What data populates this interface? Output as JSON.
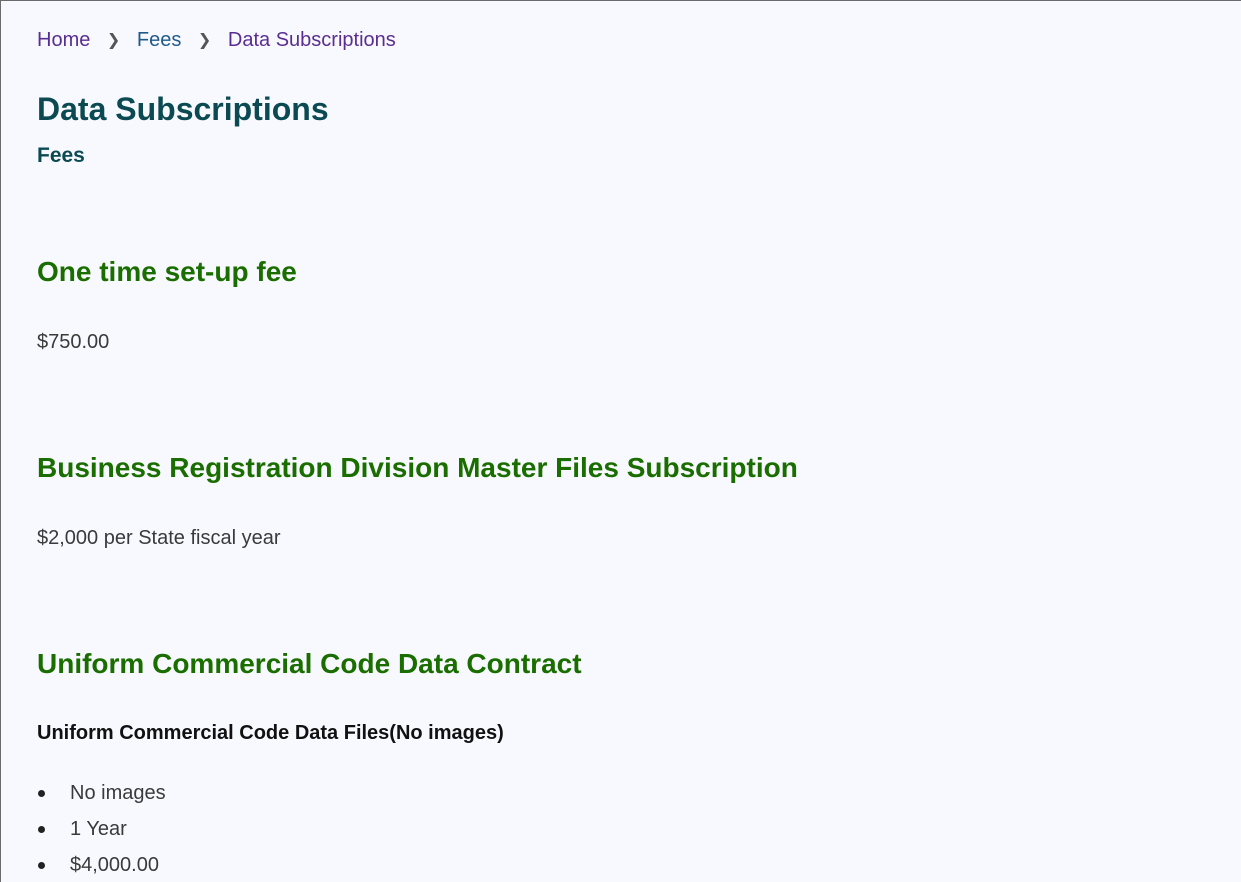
{
  "breadcrumb": {
    "home": "Home",
    "fees": "Fees",
    "current": "Data Subscriptions",
    "separator_icon": "chevron-right-icon"
  },
  "page": {
    "title": "Data Subscriptions",
    "subtitle": "Fees"
  },
  "sections": [
    {
      "heading": "One time set-up fee",
      "text": "$750.00"
    },
    {
      "heading": "Business Registration Division Master Files Subscription",
      "text": "$2,000 per State fiscal year"
    },
    {
      "heading": "Uniform Commercial Code Data Contract",
      "subheading": "Uniform Commercial Code Data Files(No images)",
      "items": [
        "No images",
        "1 Year",
        "$4,000.00"
      ]
    }
  ],
  "colors": {
    "background": "#f8f9fe",
    "title": "#0b4a52",
    "section_heading": "#1a6e00",
    "link_visited": "#5a2d91",
    "link": "#1f5a8a"
  }
}
